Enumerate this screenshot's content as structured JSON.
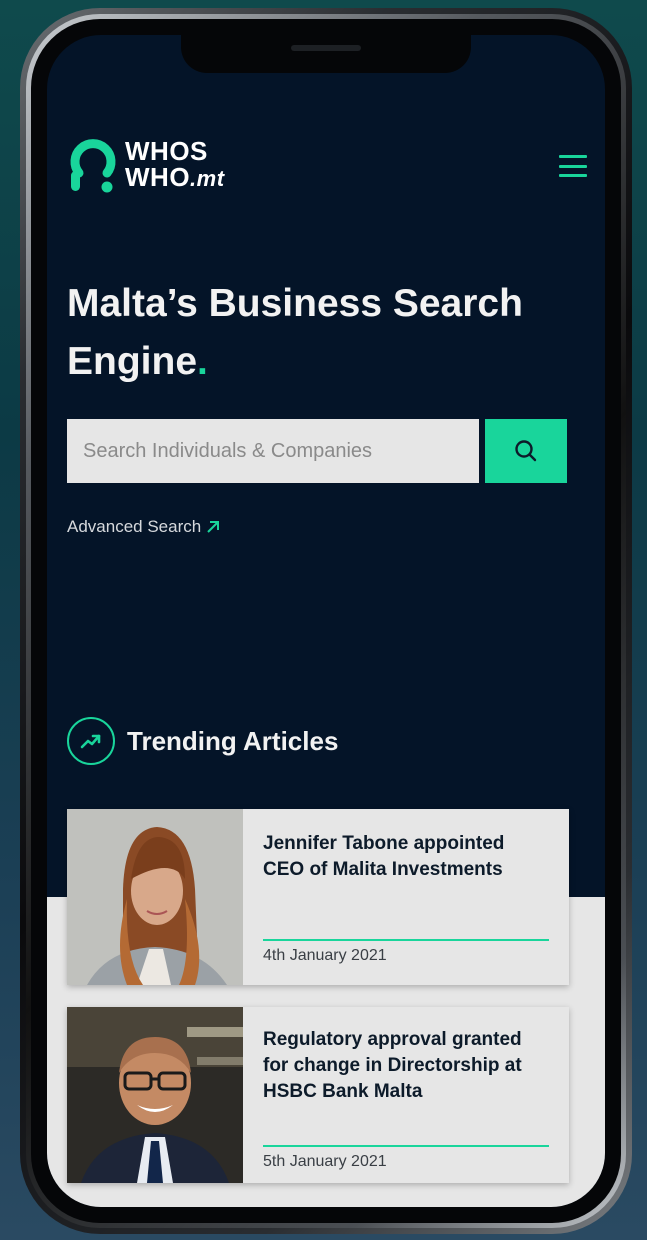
{
  "brand": {
    "logo_line1": "WHOS",
    "logo_line2": "WHO",
    "logo_suffix": ".mt",
    "accent_color": "#19d59b",
    "background_color": "#041428"
  },
  "hero": {
    "headline": "Malta’s Business Search Engine",
    "headline_dot": "."
  },
  "search": {
    "placeholder": "Search Individuals & Companies",
    "value": "",
    "advanced_label": "Advanced Search"
  },
  "trending": {
    "title": "Trending Articles",
    "articles": [
      {
        "title": "Jennifer Tabone appointed CEO of Malita Investments",
        "date": "4th January 2021"
      },
      {
        "title": "Regulatory approval granted for change in Directorship at HSBC Bank Malta",
        "date": "5th January 2021"
      }
    ]
  },
  "icons": [
    "menu-icon",
    "search-icon",
    "external-arrow-icon",
    "trending-up-icon",
    "logo-icon"
  ]
}
